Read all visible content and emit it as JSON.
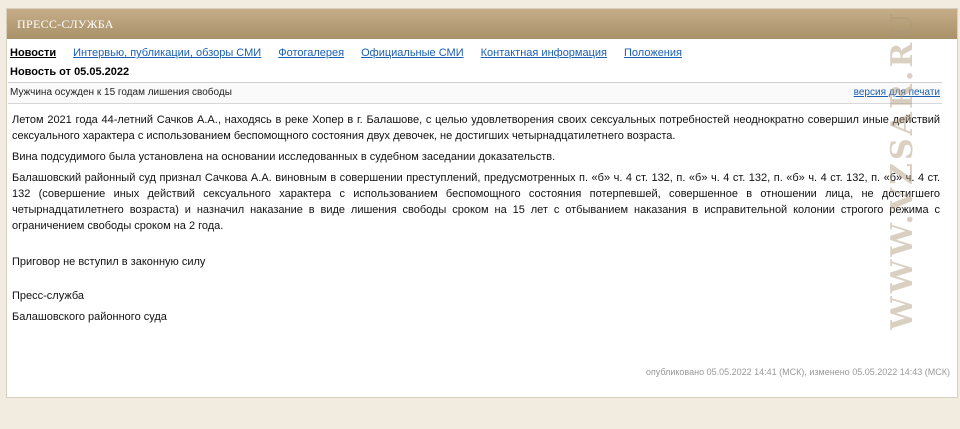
{
  "header": {
    "title": "ПРЕСС-СЛУЖБА"
  },
  "tabs": [
    {
      "label": "Новости"
    },
    {
      "label": "Интервью, публикации, обзоры СМИ"
    },
    {
      "label": "Фотогалерея"
    },
    {
      "label": "Официальные СМИ"
    },
    {
      "label": "Контактная информация"
    },
    {
      "label": "Положения"
    }
  ],
  "news": {
    "date_heading": "Новость от 05.05.2022",
    "headline": "Мужчина осужден к 15 годам лишения свободы",
    "print_link": "версия для печати",
    "paragraphs": [
      "Летом 2021 года 44-летний Сачков А.А., находясь в реке Хопер в г. Балашове, с целью удовлетворения своих сексуальных потребностей неоднократно совершил иные действий сексуального характера с использованием беспомощного состояния двух девочек, не достигших четырнадцатилетнего возраста.",
      "Вина подсудимого была установлена на основании исследованных в судебном заседании доказательств.",
      "Балашовский районный суд признал Сачкова А.А. виновным в совершении преступлений, предусмотренных п. «б» ч. 4 ст. 132, п. «б» ч. 4 ст. 132, п. «б» ч. 4 ст. 132, п. «б» ч. 4 ст. 132 (совершение иных действий сексуального характера с использованием беспомощного состояния потерпевшей, совершенное в отношении лица, не достигшего четырнадцатилетнего возраста) и назначил наказание в виде лишения свободы сроком на 15 лет с отбыванием наказания в исправительной колонии строгого режима с ограничением свободы сроком на 2 года.",
      "Приговор не вступил в законную силу",
      "Пресс-служба",
      "Балашовского районного суда"
    ],
    "published_meta": "опубликовано 05.05.2022 14:41 (МСК), изменено 05.05.2022 14:43 (МСК)"
  },
  "watermark": "WWW.VZSAR.RU"
}
